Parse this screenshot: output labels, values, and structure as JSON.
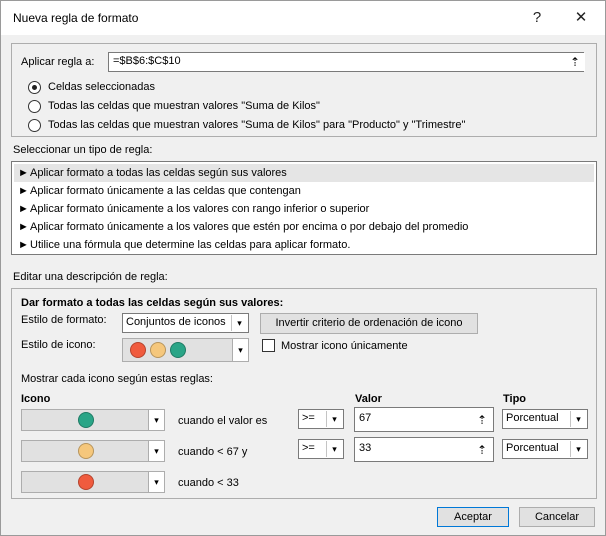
{
  "window": {
    "title": "Nueva regla de formato",
    "help": "?",
    "close": "✕"
  },
  "apply": {
    "label": "Aplicar regla a:",
    "value": "=$B$6:$C$10",
    "options": [
      {
        "label": "Celdas seleccionadas",
        "checked": true
      },
      {
        "label": "Todas las celdas que muestran valores \"Suma de Kilos\"",
        "checked": false
      },
      {
        "label": "Todas las celdas que muestran valores \"Suma de Kilos\" para \"Producto\" y \"Trimestre\"",
        "checked": false
      }
    ]
  },
  "ruletypes": {
    "label": "Seleccionar un tipo de regla:",
    "items": [
      "Aplicar formato a todas las celdas según sus valores",
      "Aplicar formato únicamente a las celdas que contengan",
      "Aplicar formato únicamente a los valores con rango inferior o superior",
      "Aplicar formato únicamente a los valores que estén por encima o por debajo del promedio",
      "Utilice una fórmula que determine las celdas para aplicar formato."
    ],
    "marker": "►"
  },
  "edit": {
    "label": "Editar una descripción de regla:",
    "heading": "Dar formato a todas las celdas según sus valores:",
    "format_style_label": "Estilo de formato:",
    "format_style_value": "Conjuntos de iconos",
    "reverse_button": "Invertir criterio de ordenación de icono",
    "icon_style_label": "Estilo de icono:",
    "show_icon_only": "Mostrar icono únicamente",
    "rules_label": "Mostrar cada icono según estas reglas:",
    "col_icon": "Icono",
    "col_value": "Valor",
    "col_type": "Tipo",
    "rows": [
      {
        "icon_color": "#2aa587",
        "condition": "cuando el valor es",
        "operator": ">=",
        "value": "67",
        "type": "Porcentual"
      },
      {
        "icon_color": "#f5c77c",
        "condition": "cuando < 67 y",
        "operator": ">=",
        "value": "33",
        "type": "Porcentual"
      },
      {
        "icon_color": "#f05b3e",
        "condition": "cuando < 33",
        "operator": "",
        "value": "",
        "type": ""
      }
    ]
  },
  "icon_style_colors": [
    "#f05b3e",
    "#f5c77c",
    "#2aa587"
  ],
  "buttons": {
    "accept": "Aceptar",
    "cancel": "Cancelar"
  },
  "glyphs": {
    "chevron": "▾",
    "ref": "⇡"
  }
}
